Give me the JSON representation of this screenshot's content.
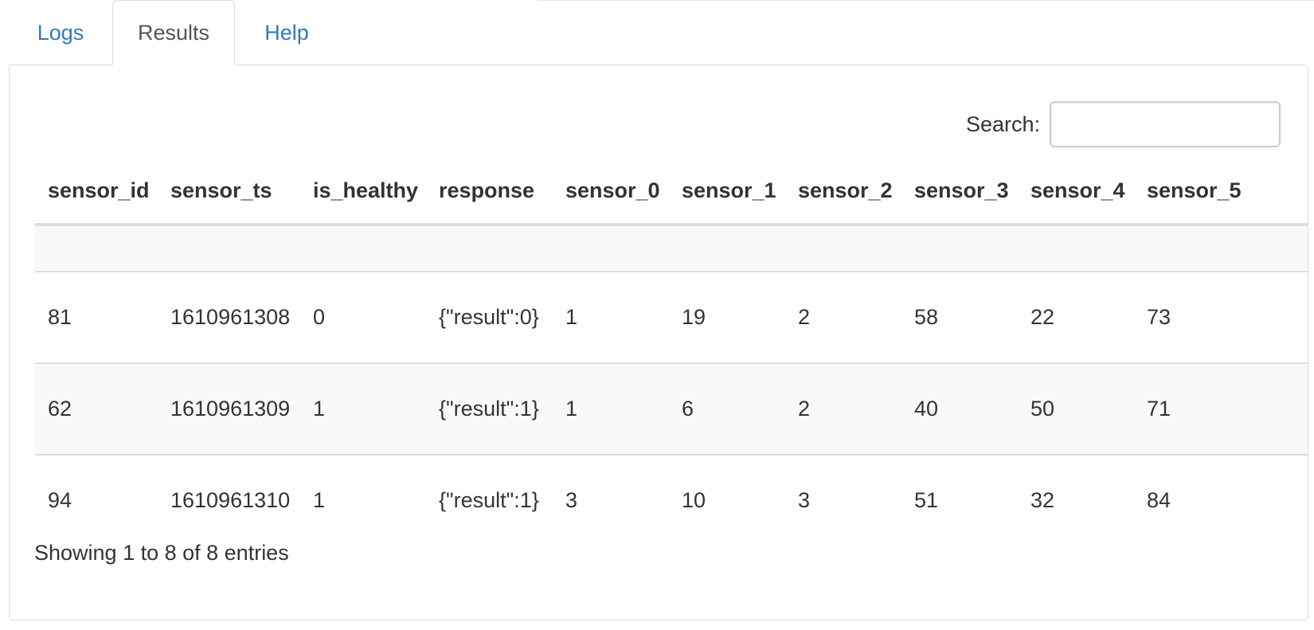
{
  "tabs": [
    {
      "label": "Logs"
    },
    {
      "label": "Results"
    },
    {
      "label": "Help"
    }
  ],
  "search": {
    "label": "Search:",
    "value": "",
    "placeholder": ""
  },
  "table": {
    "columns": [
      "sensor_id",
      "sensor_ts",
      "is_healthy",
      "response",
      "sensor_0",
      "sensor_1",
      "sensor_2",
      "sensor_3",
      "sensor_4",
      "sensor_5"
    ],
    "rows": [
      [
        "81",
        "1610961308",
        "0",
        "{\"result\":0}",
        "1",
        "19",
        "2",
        "58",
        "22",
        "73"
      ],
      [
        "62",
        "1610961309",
        "1",
        "{\"result\":1}",
        "1",
        "6",
        "2",
        "40",
        "50",
        "71"
      ],
      [
        "94",
        "1610961310",
        "1",
        "{\"result\":1}",
        "3",
        "10",
        "3",
        "51",
        "32",
        "84"
      ]
    ]
  },
  "info": "Showing 1 to 8 of 8 entries"
}
